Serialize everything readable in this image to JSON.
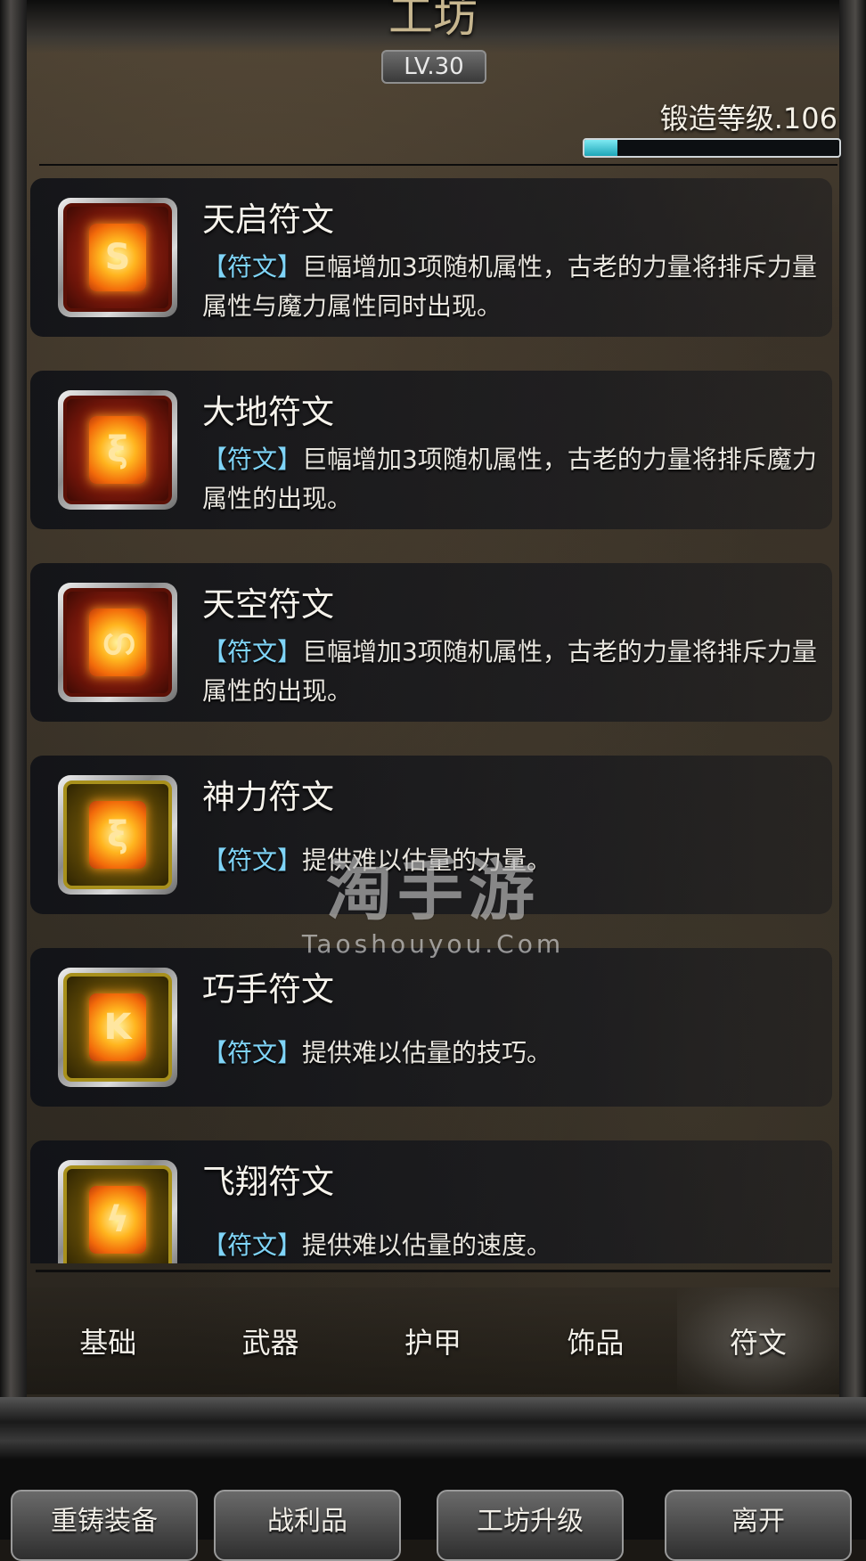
{
  "header": {
    "title": "工坊",
    "level_badge": "LV.30",
    "forge_level": "锻造等级.106",
    "forge_progress": 0.13
  },
  "runes": [
    {
      "name": "天启符文",
      "tag": "【符文】",
      "desc": "巨幅增加3项随机属性，古老的力量将排斥力量属性与魔力属性同时出现。",
      "frame": "red",
      "glyph": "S"
    },
    {
      "name": "大地符文",
      "tag": "【符文】",
      "desc": "巨幅增加3项随机属性，古老的力量将排斥魔力属性的出现。",
      "frame": "red",
      "glyph": "ξ"
    },
    {
      "name": "天空符文",
      "tag": "【符文】",
      "desc": "巨幅增加3项随机属性，古老的力量将排斥力量属性的出现。",
      "frame": "red",
      "glyph": "ഗ"
    },
    {
      "name": "神力符文",
      "tag": "【符文】",
      "desc": "提供难以估量的力量。",
      "frame": "gold",
      "glyph": "ξ"
    },
    {
      "name": "巧手符文",
      "tag": "【符文】",
      "desc": "提供难以估量的技巧。",
      "frame": "gold",
      "glyph": "K"
    },
    {
      "name": "飞翔符文",
      "tag": "【符文】",
      "desc": "提供难以估量的速度。",
      "frame": "gold",
      "glyph": "ϟ"
    }
  ],
  "watermark": {
    "logo": "淘手游",
    "url": "Taoshouyou.Com"
  },
  "tabs": [
    {
      "label": "基础",
      "active": false
    },
    {
      "label": "武器",
      "active": false
    },
    {
      "label": "护甲",
      "active": false
    },
    {
      "label": "饰品",
      "active": false
    },
    {
      "label": "符文",
      "active": true
    }
  ],
  "bottom_buttons": [
    {
      "label": "重铸装备"
    },
    {
      "label": "战利品"
    },
    {
      "label": "工坊升级"
    },
    {
      "label": "离开"
    }
  ]
}
